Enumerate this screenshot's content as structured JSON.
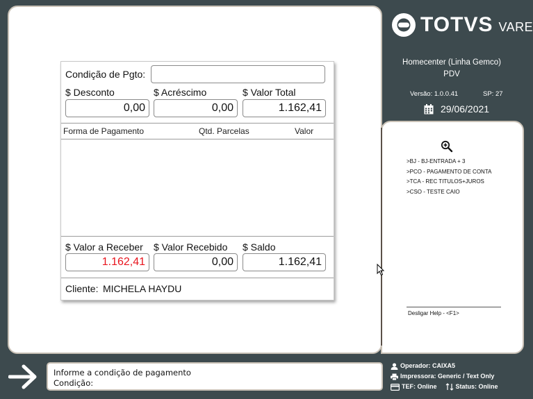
{
  "brand": {
    "name": "TOTVS",
    "sub": "VAREJO"
  },
  "store": {
    "name": "Homecenter (Linha Gemco)",
    "mode": "PDV"
  },
  "version": "Versão: 1.0.0.41",
  "sp": "SP: 27",
  "date": "29/06/2021",
  "dialog": {
    "condicao_label": "Condição de Pgto:",
    "condicao_value": "",
    "desconto_label": "$ Desconto",
    "desconto_value": "0,00",
    "acrescimo_label": "$ Acréscimo",
    "acrescimo_value": "0,00",
    "total_label": "$ Valor Total",
    "total_value": "1.162,41",
    "columns": [
      "Forma de Pagamento",
      "Qtd. Parcelas",
      "Valor"
    ],
    "receber_label": "$ Valor a Receber",
    "receber_value": "1.162,41",
    "recebido_label": "$ Valor Recebido",
    "recebido_value": "0,00",
    "saldo_label": "$ Saldo",
    "saldo_value": "1.162,41",
    "cliente_label": "Cliente:",
    "cliente_value": "MICHELA HAYDU"
  },
  "help": {
    "items": [
      ">BJ - BJ-ENTRADA + 3",
      ">PCO - PAGAMENTO DE CONTA",
      ">TCA - REC TITULOS+JUROS",
      ">CSO - TESTE CAIO"
    ],
    "disable": "Desligar Help - <F1>"
  },
  "message": {
    "line1": "Informe a condição de pagamento",
    "line2": "Condição:"
  },
  "status": {
    "operador": "Operador: CAIXA5",
    "impressora": "Impressora: Generic / Text Only",
    "tef": "TEF: Online",
    "status": "Status: Online"
  },
  "colors": {
    "background": "#3d4a4e",
    "panel_border": "#c9c1b6",
    "red_value": "#e8141d"
  }
}
